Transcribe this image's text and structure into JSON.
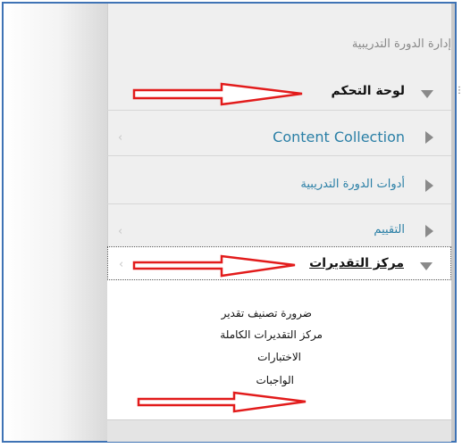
{
  "menu": {
    "title": "إدارة الدورة التدريبية",
    "items": [
      {
        "label": "لوحة التحكم"
      },
      {
        "label": "Content Collection"
      },
      {
        "label": "أدوات الدورة التدريبية"
      },
      {
        "label": "التقييم"
      },
      {
        "label": "مركز التقديرات"
      }
    ],
    "grade_center_sub": [
      {
        "label": "ضرورة تصنيف تقدير"
      },
      {
        "label": "مركز التقديرات الكاملة"
      },
      {
        "label": "الاختبارات"
      },
      {
        "label": "الواجبات"
      }
    ]
  },
  "colors": {
    "frame": "#3f73b5",
    "annotation_arrow": "#e21b1b",
    "link": "#2a7fa6"
  }
}
